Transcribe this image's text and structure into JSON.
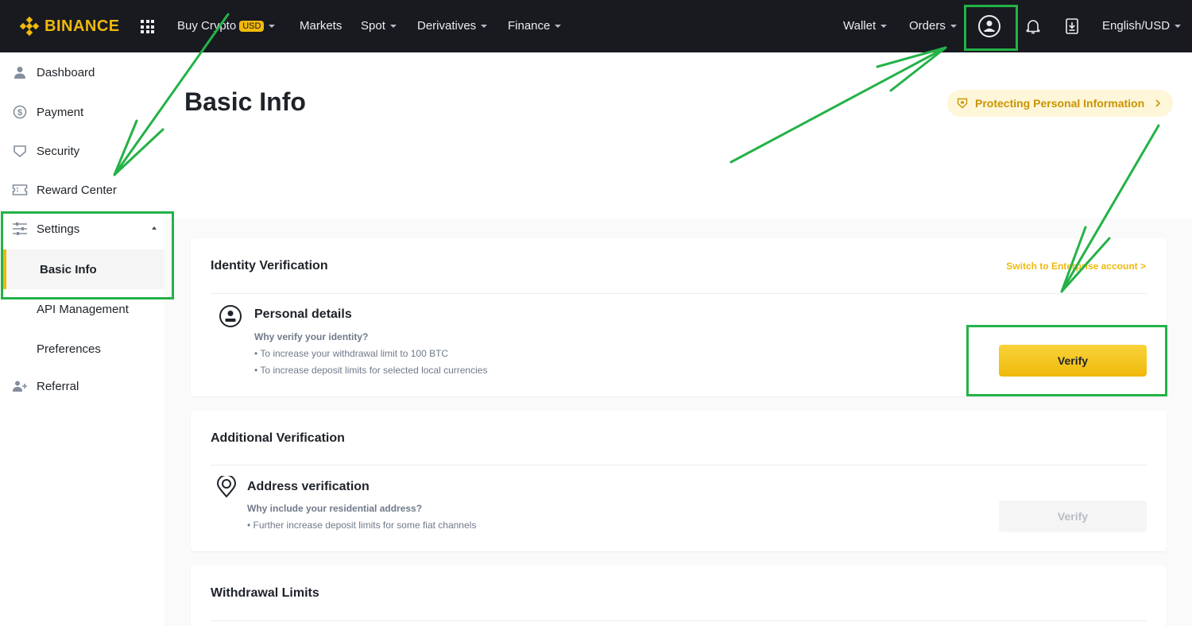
{
  "brand": {
    "name": "BINANCE",
    "color": "#f0b90b"
  },
  "nav": {
    "buy_crypto": "Buy Crypto",
    "usd_badge": "USD",
    "markets": "Markets",
    "spot": "Spot",
    "derivatives": "Derivatives",
    "finance": "Finance",
    "wallet": "Wallet",
    "orders": "Orders",
    "language": "English/USD"
  },
  "sidebar": {
    "items": [
      {
        "label": "Dashboard",
        "icon": "user-icon"
      },
      {
        "label": "Payment",
        "icon": "dollar-circle-icon"
      },
      {
        "label": "Security",
        "icon": "shield-icon"
      },
      {
        "label": "Reward Center",
        "icon": "ticket-icon"
      },
      {
        "label": "Settings",
        "icon": "sliders-icon"
      },
      {
        "label": "Referral",
        "icon": "add-user-icon"
      }
    ],
    "settings_sub": [
      "Basic Info",
      "API Management",
      "Preferences"
    ]
  },
  "page": {
    "title": "Basic Info",
    "protect_label": "Protecting Personal Information"
  },
  "identity": {
    "title": "Identity Verification",
    "switch_link": "Switch to Enterprise account >",
    "row_title": "Personal details",
    "row_sub": "Why verify your identity?",
    "bullets": [
      "• To increase your withdrawal limit to 100 BTC",
      "• To increase deposit limits for selected local currencies"
    ],
    "button": "Verify"
  },
  "additional": {
    "title": "Additional Verification",
    "row_title": "Address verification",
    "row_sub": "Why include your residential address?",
    "bullets": [
      "• Further increase deposit limits for some fiat channels"
    ],
    "button": "Verify"
  },
  "withdrawal": {
    "title": "Withdrawal Limits"
  },
  "annotation_color": "#24b247"
}
